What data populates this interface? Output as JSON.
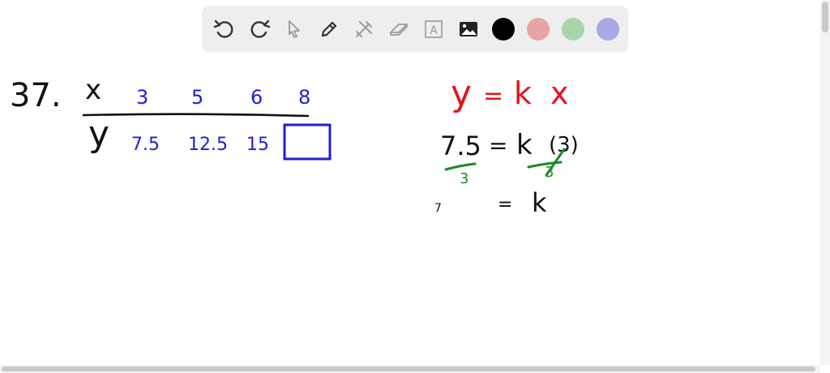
{
  "toolbar": {
    "tools": [
      {
        "icon": "undo-icon"
      },
      {
        "icon": "redo-icon"
      },
      {
        "icon": "pointer-icon"
      },
      {
        "icon": "pen-icon"
      },
      {
        "icon": "tools-icon"
      },
      {
        "icon": "eraser-icon"
      },
      {
        "icon": "text-icon",
        "glyph": "A"
      },
      {
        "icon": "image-icon"
      }
    ],
    "colors": [
      {
        "name": "black",
        "hex": "#000000",
        "selected": true
      },
      {
        "name": "red",
        "hex": "#e8a4a4",
        "selected": false
      },
      {
        "name": "green",
        "hex": "#a9d6a9",
        "selected": false
      },
      {
        "name": "blue",
        "hex": "#a6a9e6",
        "selected": false
      }
    ]
  },
  "canvas": {
    "problem_number": "37.",
    "table": {
      "x_label": "x",
      "y_label": "y",
      "x_values": [
        "3",
        "5",
        "6",
        "8"
      ],
      "y_values": [
        "7.5",
        "12.5",
        "15",
        ""
      ]
    },
    "work": {
      "equation": {
        "y": "y",
        "eq": "=",
        "k": "k",
        "x": "x"
      },
      "line2": {
        "lhs": "7.5",
        "eq": "=",
        "k": "k",
        "arg": "(3)"
      },
      "divisor_left": "3",
      "divisor_right": "3",
      "line3": {
        "lhs": "7",
        "eq": "=",
        "k": "k"
      }
    }
  },
  "colors": {
    "ink_black": "#111111",
    "ink_blue": "#1f1fd1",
    "ink_red": "#e0161d",
    "ink_green": "#1a8a25",
    "toolbar_bg": "#eeeeee"
  }
}
